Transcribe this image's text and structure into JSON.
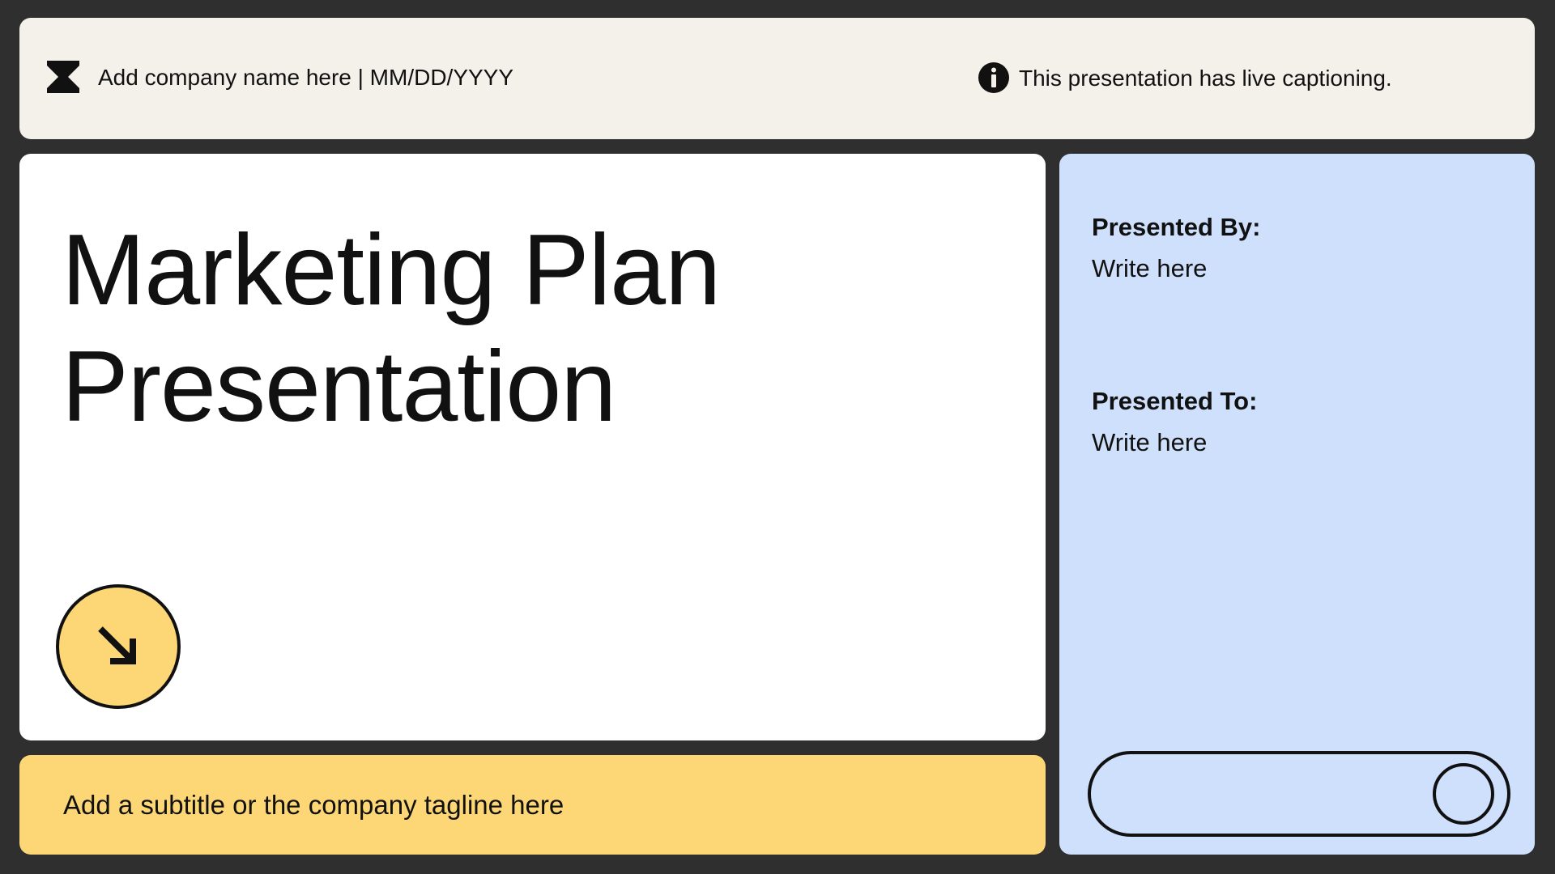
{
  "header": {
    "company_date": "Add company name here | MM/DD/YYYY",
    "logo_icon": "hourglass-icon",
    "info_icon": "info-icon",
    "caption_note": "This presentation has live captioning."
  },
  "main": {
    "title_line1": "Marketing Plan",
    "title_line2": "Presentation",
    "arrow_icon": "arrow-down-right-icon"
  },
  "subtitle": {
    "text": "Add a subtitle or the company tagline here"
  },
  "side": {
    "presented_by_label": "Presented By:",
    "presented_by_value": "Write here",
    "presented_to_label": "Presented To:",
    "presented_to_value": "Write here"
  },
  "colors": {
    "background": "#2f2f2f",
    "header_bg": "#f4f0ea",
    "card_bg": "#ffffff",
    "accent_yellow": "#fdd776",
    "side_blue": "#cfe0fc",
    "ink": "#111111"
  }
}
